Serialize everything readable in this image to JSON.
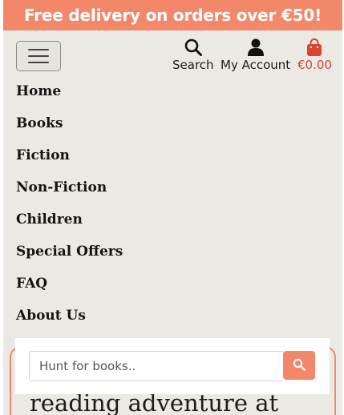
{
  "promo": {
    "text": "Free delivery on orders over €50!"
  },
  "header": {
    "search_label": "Search",
    "account_label": "My Account",
    "bag_total": "€0.00"
  },
  "nav": {
    "items": [
      {
        "label": "Home"
      },
      {
        "label": "Books"
      },
      {
        "label": "Fiction"
      },
      {
        "label": "Non-Fiction"
      },
      {
        "label": "Children"
      },
      {
        "label": "Special Offers"
      },
      {
        "label": "FAQ"
      },
      {
        "label": "About Us"
      }
    ]
  },
  "search": {
    "placeholder": "Hunt for books.."
  },
  "hero": {
    "text": "reading adventure at"
  },
  "colors": {
    "accent": "#f3876a",
    "bag": "#d9432f",
    "background": "#ebe9e4"
  },
  "icons": {
    "menu": "hamburger-icon",
    "search": "search-icon",
    "account": "user-icon",
    "bag": "shopping-bag-icon"
  }
}
